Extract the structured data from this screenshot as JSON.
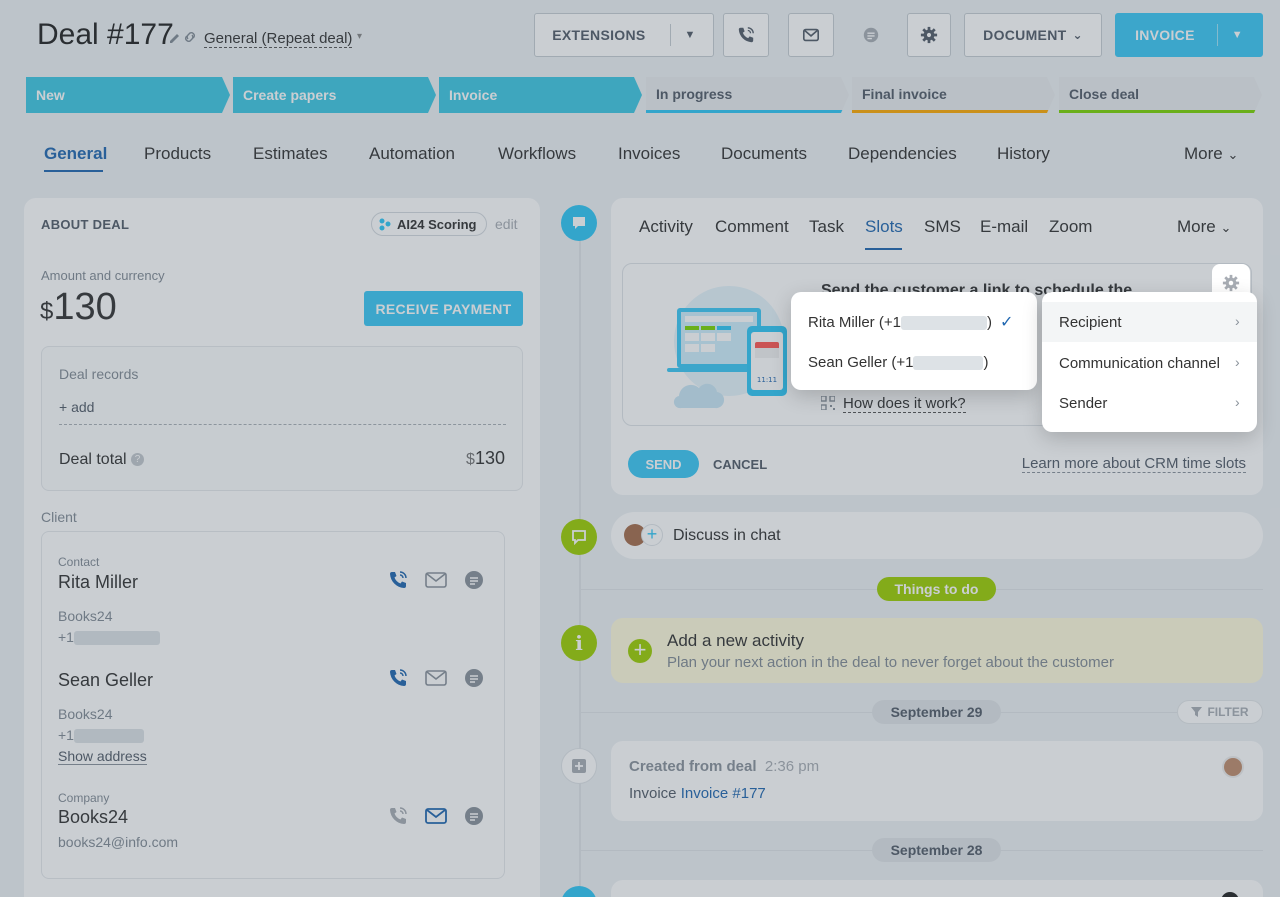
{
  "header": {
    "title": "Deal #177",
    "category": "General (Repeat deal)",
    "extensions_label": "EXTENSIONS",
    "document_label": "DOCUMENT",
    "invoice_label": "INVOICE"
  },
  "stages": [
    {
      "label": "New",
      "state": "active"
    },
    {
      "label": "Create papers",
      "state": "active"
    },
    {
      "label": "Invoice",
      "state": "active"
    },
    {
      "label": "In progress",
      "state": "inactive",
      "color": "#2fc6f6"
    },
    {
      "label": "Final invoice",
      "state": "inactive",
      "color": "#ffa900"
    },
    {
      "label": "Close deal",
      "state": "inactive",
      "color": "#7bd500"
    }
  ],
  "tabs": [
    "General",
    "Products",
    "Estimates",
    "Automation",
    "Workflows",
    "Invoices",
    "Documents",
    "Dependencies",
    "History",
    "More"
  ],
  "about": {
    "heading": "ABOUT DEAL",
    "scoring": "AI24 Scoring",
    "edit": "edit",
    "amount_label": "Amount and currency",
    "currency": "$",
    "amount": "130",
    "receive_payment": "RECEIVE PAYMENT",
    "records_label": "Deal records",
    "add": "+ add",
    "total_label": "Deal total",
    "total_currency": "$",
    "total_value": "130",
    "client_label": "Client"
  },
  "client": {
    "contact_label": "Contact",
    "contact1_name": "Rita Miller",
    "contact1_company": "Books24",
    "contact1_phone": "+1",
    "contact2_name": "Sean Geller",
    "contact2_company": "Books24",
    "contact2_phone": "+1",
    "show_address": "Show address",
    "company_label": "Company",
    "company_name": "Books24",
    "company_email": "books24@info.com"
  },
  "timeline_tabs": [
    "Activity",
    "Comment",
    "Task",
    "Slots",
    "SMS",
    "E-mail",
    "Zoom",
    "More"
  ],
  "slots": {
    "message_title": "Send the customer a link to schedule the",
    "how": "How does it work?",
    "send": "SEND",
    "cancel": "CANCEL",
    "learn_more": "Learn more about CRM time slots",
    "clock_text": "11:11"
  },
  "recipient_menu": {
    "rita": "Rita Miller (+1",
    "sean": "Sean Geller (+1",
    "close_paren": ")"
  },
  "settings_menu": {
    "recipient": "Recipient",
    "channel": "Communication channel",
    "sender": "Sender"
  },
  "chat": {
    "label": "Discuss in chat"
  },
  "things_to_do": "Things to do",
  "activity": {
    "title": "Add a new activity",
    "subtitle": "Plan your next action in the deal to never forget about the customer"
  },
  "date1": "September 29",
  "filter": "FILTER",
  "created": {
    "title": "Created from deal",
    "time": "2:36 pm",
    "prefix": "Invoice",
    "link": "Invoice #177"
  },
  "date2": "September 28"
}
